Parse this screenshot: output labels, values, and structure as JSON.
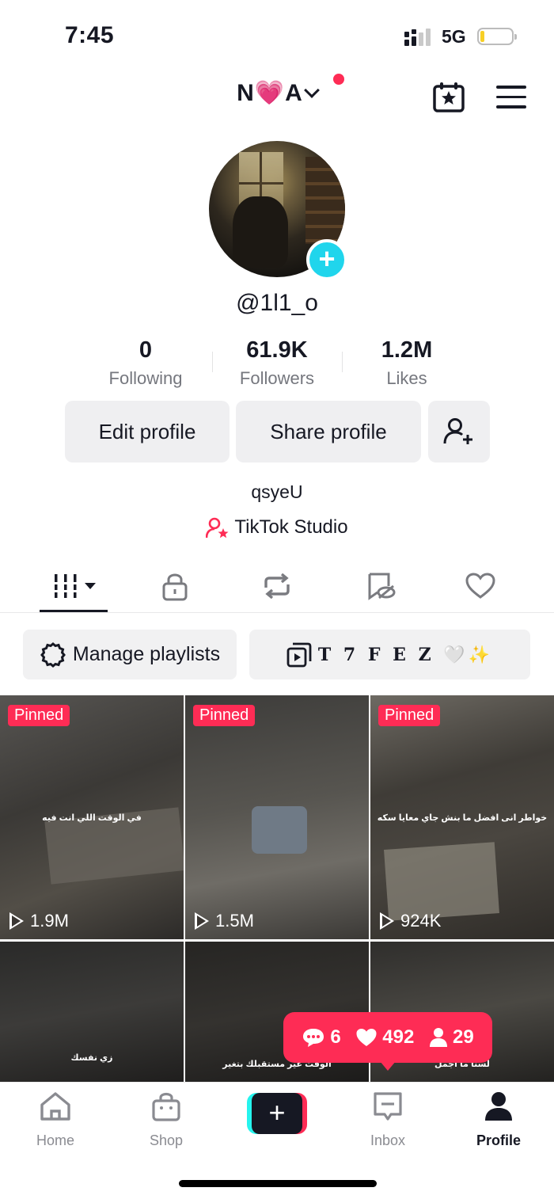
{
  "status_bar": {
    "time": "7:45",
    "network": "5G"
  },
  "header": {
    "display_name": "N💗A"
  },
  "profile": {
    "username": "@1l1_o",
    "bio": "qsyeU",
    "studio_label": "TikTok Studio"
  },
  "stats": [
    {
      "value": "0",
      "label": "Following"
    },
    {
      "value": "61.9K",
      "label": "Followers"
    },
    {
      "value": "1.2M",
      "label": "Likes"
    }
  ],
  "buttons": {
    "edit": "Edit profile",
    "share": "Share profile"
  },
  "tabs": [
    "videos-grid",
    "private",
    "reposts",
    "favorites",
    "liked"
  ],
  "playlists": {
    "manage": "Manage playlists",
    "playlist_name": "T 7 F E Z 🤍✨"
  },
  "videos": [
    {
      "pinned": "Pinned",
      "views": "1.9M",
      "caption": "في الوقت اللي انت فيه"
    },
    {
      "pinned": "Pinned",
      "views": "1.5M",
      "caption": ""
    },
    {
      "pinned": "Pinned",
      "views": "924K",
      "caption": "خواطر انى افضل ما بنش جاي معايا سكه"
    },
    {
      "pinned": "",
      "views": "",
      "caption": "زي نفسك"
    },
    {
      "pinned": "",
      "views": "",
      "caption": "الوقت غير مستقبلك بتغير"
    },
    {
      "pinned": "",
      "views": "",
      "caption": "لسنا ما اجمل"
    }
  ],
  "notification": {
    "comments": "6",
    "likes": "492",
    "followers": "29"
  },
  "bottom_nav": {
    "home": "Home",
    "shop": "Shop",
    "inbox": "Inbox",
    "profile": "Profile"
  },
  "colors": {
    "accent": "#fe2c55",
    "cyan": "#25f4ee",
    "text": "#161823",
    "muted": "#75777e"
  }
}
